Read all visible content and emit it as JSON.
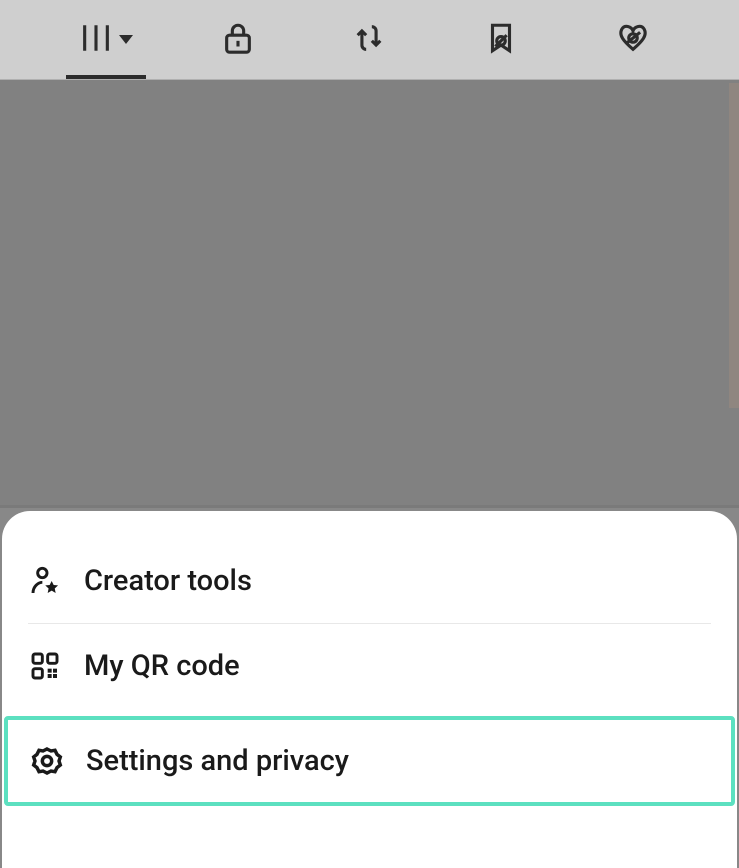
{
  "tabs": {
    "grid_active": true
  },
  "sheet": {
    "items": [
      {
        "label": "Creator tools"
      },
      {
        "label": "My QR code"
      },
      {
        "label": "Settings and privacy"
      }
    ]
  }
}
